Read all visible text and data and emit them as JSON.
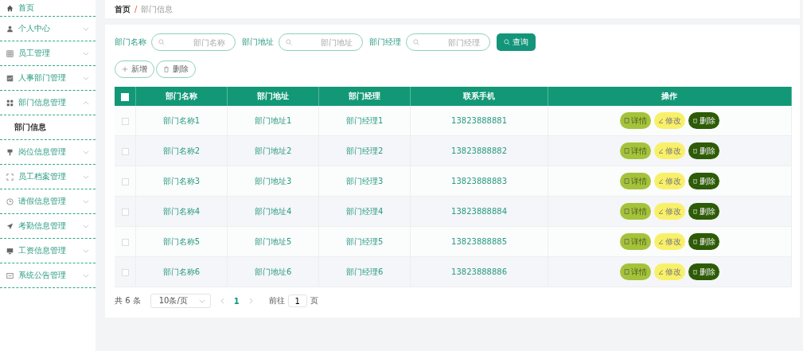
{
  "sidebar": {
    "items": [
      {
        "label": "首页"
      },
      {
        "label": "个人中心",
        "expanded": false
      },
      {
        "label": "员工管理",
        "expanded": false
      },
      {
        "label": "人事部门管理",
        "expanded": false
      },
      {
        "label": "部门信息管理",
        "expanded": true,
        "children": [
          {
            "label": "部门信息"
          }
        ]
      },
      {
        "label": "岗位信息管理",
        "expanded": false
      },
      {
        "label": "员工档案管理",
        "expanded": false
      },
      {
        "label": "请假信息管理",
        "expanded": false
      },
      {
        "label": "考勤信息管理",
        "expanded": false
      },
      {
        "label": "工资信息管理",
        "expanded": false
      },
      {
        "label": "系统公告管理",
        "expanded": false
      }
    ]
  },
  "breadcrumb": [
    "首页",
    "/",
    "部门信息"
  ],
  "filters": [
    {
      "label": "部门名称",
      "placeholder": "部门名称"
    },
    {
      "label": "部门地址",
      "placeholder": "部门地址"
    },
    {
      "label": "部门经理",
      "placeholder": "部门经理"
    }
  ],
  "search_button": "查询",
  "toolbar": [
    {
      "kind": "add",
      "label": "新增"
    },
    {
      "kind": "delete",
      "label": "删除"
    }
  ],
  "table": {
    "select_all": false,
    "columns": [
      "部门名称",
      "部门地址",
      "部门经理",
      "联系手机",
      "操作"
    ],
    "rows": [
      {
        "selected": false,
        "cells": [
          "部门名称1",
          "部门地址1",
          "部门经理1",
          "13823888881"
        ],
        "actions": [
          {
            "kind": "detail",
            "label": "详情"
          },
          {
            "kind": "edit",
            "label": "修改"
          },
          {
            "kind": "delete",
            "label": "删除"
          }
        ]
      },
      {
        "selected": false,
        "cells": [
          "部门名称2",
          "部门地址2",
          "部门经理2",
          "13823888882"
        ],
        "actions": [
          {
            "kind": "detail",
            "label": "详情"
          },
          {
            "kind": "edit",
            "label": "修改"
          },
          {
            "kind": "delete",
            "label": "删除"
          }
        ]
      },
      {
        "selected": false,
        "cells": [
          "部门名称3",
          "部门地址3",
          "部门经理3",
          "13823888883"
        ],
        "actions": [
          {
            "kind": "detail",
            "label": "详情"
          },
          {
            "kind": "edit",
            "label": "修改"
          },
          {
            "kind": "delete",
            "label": "删除"
          }
        ]
      },
      {
        "selected": false,
        "cells": [
          "部门名称4",
          "部门地址4",
          "部门经理4",
          "13823888884"
        ],
        "actions": [
          {
            "kind": "detail",
            "label": "详情"
          },
          {
            "kind": "edit",
            "label": "修改"
          },
          {
            "kind": "delete",
            "label": "删除"
          }
        ]
      },
      {
        "selected": false,
        "cells": [
          "部门名称5",
          "部门地址5",
          "部门经理5",
          "13823888885"
        ],
        "actions": [
          {
            "kind": "detail",
            "label": "详情"
          },
          {
            "kind": "edit",
            "label": "修改"
          },
          {
            "kind": "delete",
            "label": "删除"
          }
        ]
      },
      {
        "selected": false,
        "cells": [
          "部门名称6",
          "部门地址6",
          "部门经理6",
          "13823888886"
        ],
        "actions": [
          {
            "kind": "detail",
            "label": "详情"
          },
          {
            "kind": "edit",
            "label": "修改"
          },
          {
            "kind": "delete",
            "label": "删除"
          }
        ]
      }
    ]
  },
  "pagination": {
    "total": "共 6 条",
    "page_size": "10条/页",
    "pages": [
      {
        "label": "1",
        "selected": true
      }
    ],
    "goto_label": "前往",
    "goto_value": "1",
    "goto_suffix": "页"
  }
}
